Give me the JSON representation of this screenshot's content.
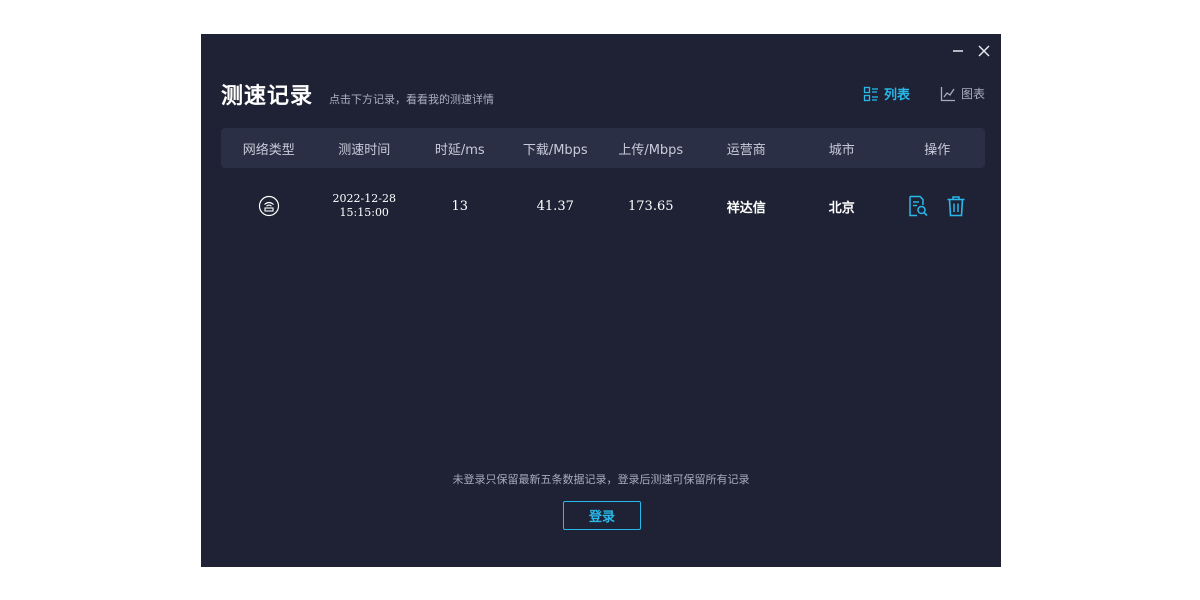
{
  "window": {
    "controls": {
      "minimize_icon": "minimize-icon",
      "close_icon": "close-icon"
    }
  },
  "header": {
    "title": "测速记录",
    "subtitle": "点击下方记录，看看我的测速详情"
  },
  "view_toggle": {
    "list_label": "列表",
    "chart_label": "图表",
    "active": "list"
  },
  "table": {
    "columns": [
      "网络类型",
      "测速时间",
      "时延/ms",
      "下载/Mbps",
      "上传/Mbps",
      "运营商",
      "城市",
      "操作"
    ],
    "rows": [
      {
        "network_icon": "ethernet-icon",
        "date": "2022-12-28",
        "time": "15:15:00",
        "latency": "13",
        "download": "41.37",
        "upload": "173.65",
        "isp": "祥达信",
        "city": "北京"
      }
    ]
  },
  "footer": {
    "notice": "未登录只保留最新五条数据记录，登录后测速可保留所有记录",
    "login_label": "登录"
  },
  "colors": {
    "background": "#1f2234",
    "header_row": "#2b2f45",
    "accent": "#28b8ea"
  }
}
